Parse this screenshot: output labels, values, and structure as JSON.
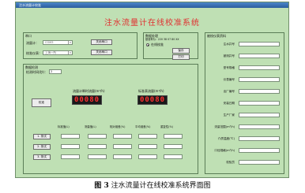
{
  "window": {
    "title": "注水流量计校准"
  },
  "main_title": "注水流量计在线校准系统",
  "serial": {
    "group_label": "串口",
    "flow_label": "流量计：",
    "flow_value": "COM3",
    "flow_button": "关闭串口",
    "calib_label": "校准仪表：",
    "calib_value": "上海一所",
    "calib_button": "关闭串口"
  },
  "mode": {
    "group_label": "数据处理",
    "param_line": "基准率为：220 38 07 80 XX",
    "radio_label": "在线校准",
    "save_button": "保存",
    "print_button": "打印"
  },
  "info": {
    "group_label": "被校仪表资料",
    "fields": [
      "注水井号",
      "被测井号",
      "型号规格",
      "仪表编号",
      "出厂编号",
      "安装日期",
      "生产厂家",
      "流量范围(m³/h)",
      "介质温度(℃)",
      "口径规格(m³/h)",
      "校验员"
    ]
  },
  "data": {
    "group_label": "数据检测",
    "interval_label": "检测时间(秒)：",
    "interval_value": "2",
    "calibrate_button": "校准",
    "flow_display_label": "流量计瞬时流量(m³/h)",
    "flow_display_value": "00080",
    "ref_display_label": "标准表流量(m³/h)",
    "ref_display_value": "00080",
    "table_headers": [
      "标准值(L)",
      "测量值(L)",
      "相对误差(%)",
      "平均误差(%)",
      "重复性(%)"
    ],
    "row_buttons": [
      "1. 测试",
      "2. 测试",
      "3. 测试"
    ]
  },
  "caption": {
    "figure_number": "图 3",
    "text": "注水流量计在线校准系统界面图"
  }
}
